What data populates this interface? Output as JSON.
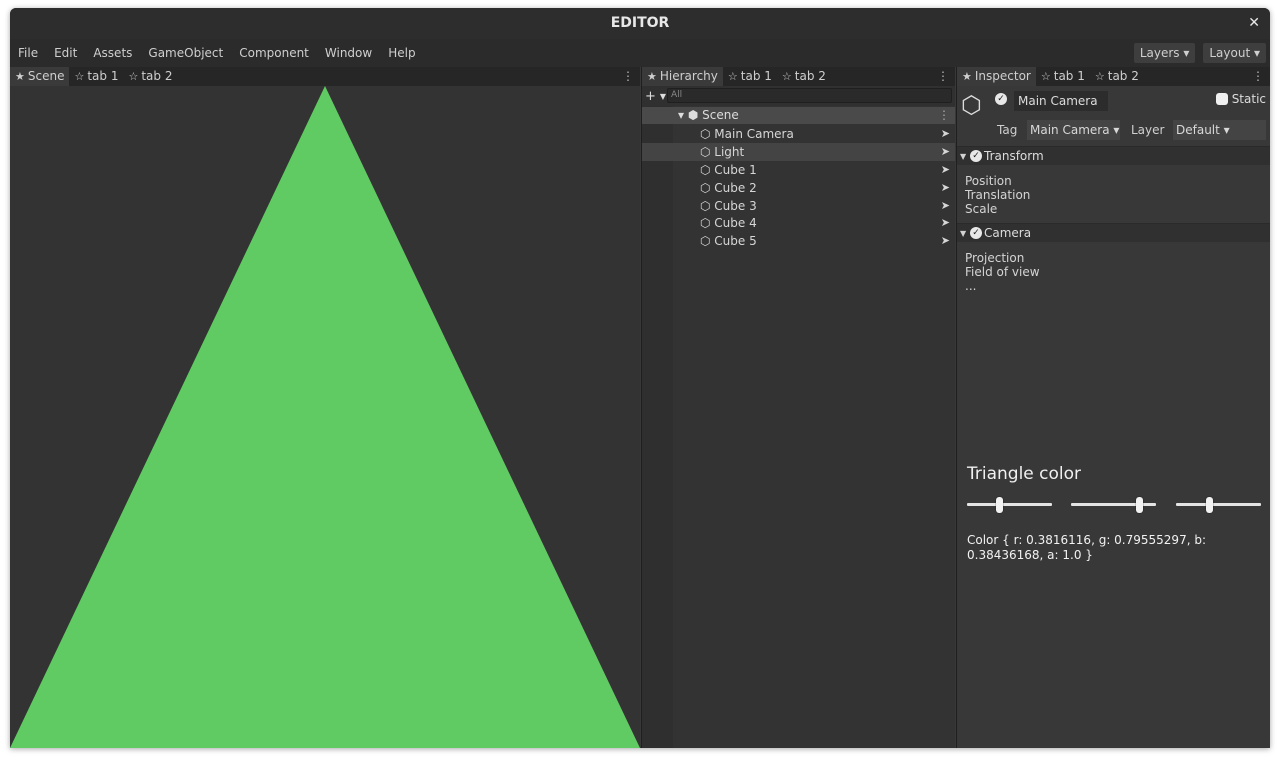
{
  "window": {
    "title": "EDITOR",
    "close_glyph": "✕"
  },
  "menu": {
    "items": [
      "File",
      "Edit",
      "Assets",
      "GameObject",
      "Component",
      "Window",
      "Help"
    ],
    "layers_label": "Layers ▾",
    "layout_label": "Layout ▾"
  },
  "scene_panel": {
    "tabs": [
      {
        "star": "★",
        "label": "Scene"
      },
      {
        "star": "☆",
        "label": "tab 1"
      },
      {
        "star": "☆",
        "label": "tab 2"
      }
    ],
    "menu_glyph": "⋮",
    "triangle_color": "#61cb63",
    "canvas_color": "#333333"
  },
  "hierarchy": {
    "tabs": [
      {
        "star": "★",
        "label": "Hierarchy"
      },
      {
        "star": "☆",
        "label": "tab 1"
      },
      {
        "star": "☆",
        "label": "tab 2"
      }
    ],
    "menu_glyph": "⋮",
    "add_glyph": "+",
    "add_arrow": "▼",
    "search_placeholder": "All",
    "scene_label": "▾ ⬢ Scene",
    "scene_menu": "⋮",
    "items": [
      {
        "label": "⬡ Main Camera",
        "go": "➤",
        "selected": false
      },
      {
        "label": "⬡ Light",
        "go": "➤",
        "selected": true
      },
      {
        "label": "⬡ Cube 1",
        "go": "➤",
        "selected": false
      },
      {
        "label": "⬡ Cube 2",
        "go": "➤",
        "selected": false
      },
      {
        "label": "⬡ Cube 3",
        "go": "➤",
        "selected": false
      },
      {
        "label": "⬡ Cube 4",
        "go": "➤",
        "selected": false
      },
      {
        "label": "⬡ Cube 5",
        "go": "➤",
        "selected": false
      }
    ]
  },
  "inspector": {
    "tabs": [
      {
        "star": "★",
        "label": "Inspector"
      },
      {
        "star": "☆",
        "label": "tab 1"
      },
      {
        "star": "☆",
        "label": "tab 2"
      }
    ],
    "menu_glyph": "⋮",
    "object_icon": "⬡",
    "check_glyph": "✓",
    "object_name": "Main Camera",
    "static_label": "Static",
    "tag_label": "Tag",
    "tag_value": "Main Camera ▾",
    "layer_label": "Layer",
    "layer_value": "Default ▾",
    "transform": {
      "title": "Transform",
      "arrow": "▼",
      "props": [
        "Position",
        "Translation",
        "Scale"
      ]
    },
    "camera": {
      "title": "Camera",
      "arrow": "▼",
      "props": [
        "Projection",
        "Field of view",
        "..."
      ]
    },
    "triangle_color_title": "Triangle color",
    "sliders": [
      {
        "channel": "r",
        "value": 0.3816116
      },
      {
        "channel": "g",
        "value": 0.79555297
      },
      {
        "channel": "b",
        "value": 0.38436168
      }
    ],
    "color_text": "Color { r: 0.3816116, g: 0.79555297, b: 0.38436168, a: 1.0 }"
  }
}
